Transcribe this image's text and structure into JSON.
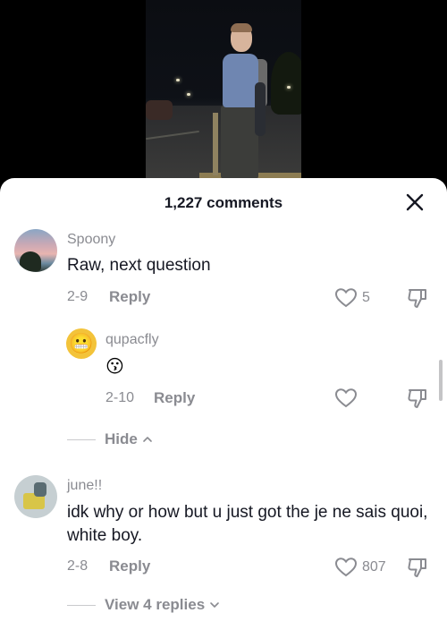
{
  "sheet": {
    "title": "1,227 comments"
  },
  "comments": [
    {
      "username": "Spoony",
      "text": "Raw, next question",
      "date": "2-9",
      "reply_label": "Reply",
      "likes": "5",
      "replies": [
        {
          "username": "qupacfly",
          "text": "😗",
          "date": "2-10",
          "reply_label": "Reply",
          "likes": ""
        }
      ],
      "thread_toggle": "Hide"
    },
    {
      "username": "june!!",
      "text": "idk why or how but u just got the je ne sais quoi, white boy.",
      "date": "2-8",
      "reply_label": "Reply",
      "likes": "807",
      "thread_toggle": "View 4 replies"
    }
  ],
  "icons": {
    "close": "close-icon",
    "like": "heart-outline-icon",
    "dislike": "thumbs-down-outline-icon",
    "hide_chevron": "chevron-up-icon",
    "view_chevron": "chevron-down-icon"
  },
  "colors": {
    "text": "#161823",
    "muted": "#8a8b91",
    "background": "#ffffff"
  }
}
